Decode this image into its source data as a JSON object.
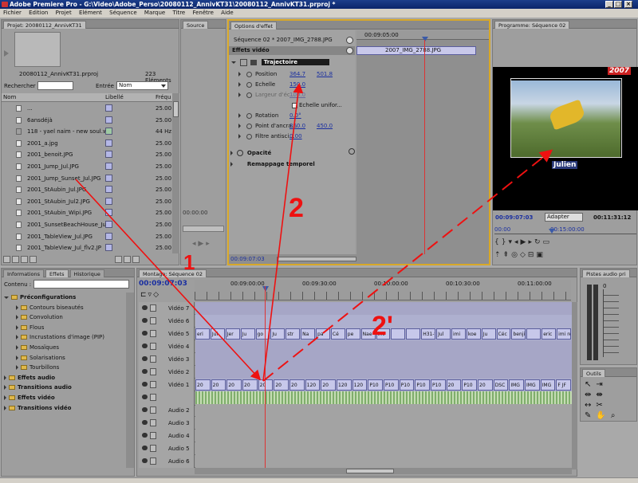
{
  "window": {
    "title": "Adobe Premiere Pro - G:\\Video\\Adobe_Perso\\20080112_AnnivKT31\\20080112_AnnivKT31.prproj *"
  },
  "menu": [
    "Fichier",
    "Edition",
    "Projet",
    "Elément",
    "Séquence",
    "Marque",
    "Titre",
    "Fenêtre",
    "Aide"
  ],
  "project": {
    "tab": "Projet: 20080112_AnnivKT31",
    "filename": "20080112_AnnivKT31.prproj",
    "count": "223 Eléments",
    "search_label": "Rechercher :",
    "entry_label": "Entrée :",
    "entry_value": "Nom",
    "columns": [
      "Nom",
      "Libellé",
      "Fréqu"
    ],
    "items": [
      {
        "name": "...",
        "rate": "25.00"
      },
      {
        "name": "6ansdéjà",
        "rate": "25.00"
      },
      {
        "name": "118 - yael naim - new soul.w",
        "rate": "44 Hz"
      },
      {
        "name": "2001_a.jpg",
        "rate": "25.00"
      },
      {
        "name": "2001_benoit.JPG",
        "rate": "25.00"
      },
      {
        "name": "2001_Jump_Jul.JPG",
        "rate": "25.00"
      },
      {
        "name": "2001_Jump_Sunset_Jul.JPG",
        "rate": "25.00"
      },
      {
        "name": "2001_StAubin_Jul.JPG",
        "rate": "25.00"
      },
      {
        "name": "2001_StAubin_Jul2.JPG",
        "rate": "25.00"
      },
      {
        "name": "2001_StAubin_Wipi.JPG",
        "rate": "25.00"
      },
      {
        "name": "2001_SunsetBeachHouse_Jul",
        "rate": "25.00"
      },
      {
        "name": "2001_TableView_Jul.JPG",
        "rate": "25.00"
      },
      {
        "name": "2001_TableView_Jul_flv2.JP",
        "rate": "25.00"
      }
    ]
  },
  "source": {
    "tab": "Source",
    "timecode": "00:00:00"
  },
  "effect_controls": {
    "tab": "Options d'effet",
    "sequence_clip": "Séquence 02 * 2007_IMG_2788.JPG",
    "header": "Effets vidéo",
    "timecode_ruler": "00:09:05:00",
    "clip_label": "2007_IMG_2788.JPG",
    "motion": "Trajectoire",
    "rows": [
      {
        "label": "Position",
        "v1": "364.7",
        "v2": "501.8"
      },
      {
        "label": "Echelle",
        "v1": "150.0",
        "v2": ""
      },
      {
        "label": "Largeur d'éc...",
        "v1": "100.0",
        "v2": ""
      },
      {
        "label": "Echelle unifor...",
        "v1": "",
        "v2": ""
      },
      {
        "label": "Rotation",
        "v1": "0.0°",
        "v2": ""
      },
      {
        "label": "Point d'ancra...",
        "v1": "360.0",
        "v2": "450.0"
      },
      {
        "label": "Filtre antisci...",
        "v1": "0.00",
        "v2": ""
      }
    ],
    "opacity": "Opacité",
    "remap": "Remappage temporel",
    "bottom_timecode": "00:09:07:03"
  },
  "program": {
    "tab": "Programme: Séquence 02",
    "year_badge": "2007",
    "caption": "Julien",
    "timecode": "00:09:07:03",
    "fit": "Adapter",
    "duration": "00:11:31:12",
    "ruler_start": "00:00",
    "ruler_mid": "00:15:00:00"
  },
  "effects": {
    "tabs": [
      "Informations",
      "Effets",
      "Historique"
    ],
    "contents_label": "Contenu :",
    "tree": [
      {
        "label": "Préconfigurations",
        "level": 0,
        "open": true,
        "bold": true
      },
      {
        "label": "Contours biseautés",
        "level": 1
      },
      {
        "label": "Convolution",
        "level": 1
      },
      {
        "label": "Flous",
        "level": 1
      },
      {
        "label": "Incrustations d'image (PIP)",
        "level": 1
      },
      {
        "label": "Mosaïques",
        "level": 1
      },
      {
        "label": "Solarisations",
        "level": 1
      },
      {
        "label": "Tourbillons",
        "level": 1
      },
      {
        "label": "Effets audio",
        "level": 0,
        "bold": true
      },
      {
        "label": "Transitions audio",
        "level": 0,
        "bold": true
      },
      {
        "label": "Effets vidéo",
        "level": 0,
        "bold": true
      },
      {
        "label": "Transitions vidéo",
        "level": 0,
        "bold": true
      }
    ]
  },
  "timeline": {
    "tab": "Montage: Séquence 02",
    "timecode": "00:09:07:03",
    "ruler": [
      "00:09:00:00",
      "00:09:30:00",
      "00:10:00:00",
      "00:10:30:00",
      "00:11:00:00"
    ],
    "tracks": [
      "Vidéo 7",
      "Vidéo 6",
      "Vidéo 5",
      "Vidéo 4",
      "Vidéo 3",
      "Vidéo 2",
      "Vidéo 1",
      "",
      "Audio 2",
      "Audio 3",
      "Audio 4",
      "Audio 5",
      "Audio 6"
    ],
    "v5_clips": [
      "eri",
      "Jul",
      "Jer",
      "Ju",
      "go",
      "Ju",
      "str",
      "Na",
      "pa",
      "Cé",
      "pe",
      "Nae",
      "imi",
      "",
      "",
      "H31-tit",
      "Jul",
      "imi",
      "koe",
      "Ju",
      "Céc",
      "benji",
      "",
      "eric",
      "imi reb"
    ],
    "v1_clips": [
      "20",
      "20",
      "20",
      "20",
      "20",
      "20",
      "20",
      "120",
      "20",
      "120",
      "120",
      "P10",
      "P10",
      "P10",
      "P10",
      "P10",
      "20",
      "P10",
      "20",
      "DSC",
      "IMG",
      "IMG",
      "IMG",
      "F JF"
    ]
  },
  "audio_master": {
    "tab": "Pistes audio pri",
    "value": "0"
  },
  "tools": {
    "tab": "Outils"
  },
  "annotations": {
    "one": "1",
    "two": "2",
    "two_prime": "2'"
  }
}
